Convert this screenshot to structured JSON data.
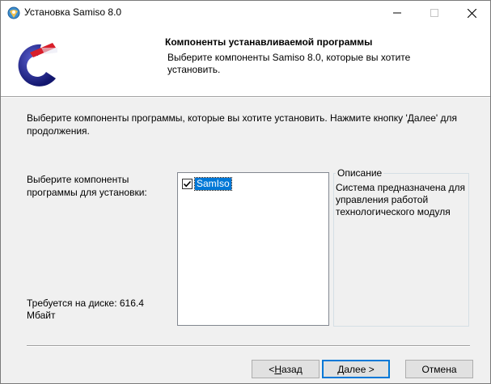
{
  "window": {
    "title": "Установка Samiso 8.0",
    "minimize_glyph": "—",
    "close_glyph": "✕"
  },
  "header": {
    "title": "Компоненты устанавливаемой программы",
    "subtitle": "Выберите компоненты Samiso 8.0, которые вы хотите установить."
  },
  "body": {
    "intro": "Выберите компоненты программы, которые вы хотите установить. Нажмите кнопку 'Далее' для продолжения.",
    "select_label": "Выберите компоненты программы для установки:",
    "disk_label": "Требуется на диске: 616.4 Мбайт"
  },
  "components": [
    {
      "label": "SamIso",
      "checked": true
    }
  ],
  "description": {
    "title": "Описание",
    "text": "Система предназначена для управления работой технологического модуля"
  },
  "buttons": {
    "back_prefix": "< ",
    "back_hotkey": "Н",
    "back_rest": "азад",
    "next_hotkey": "Д",
    "next_rest": "алее >",
    "cancel": "Отмена"
  },
  "colors": {
    "accent": "#0078d7",
    "logo_red": "#d81e2a",
    "logo_blue": "#1a1f8c"
  }
}
